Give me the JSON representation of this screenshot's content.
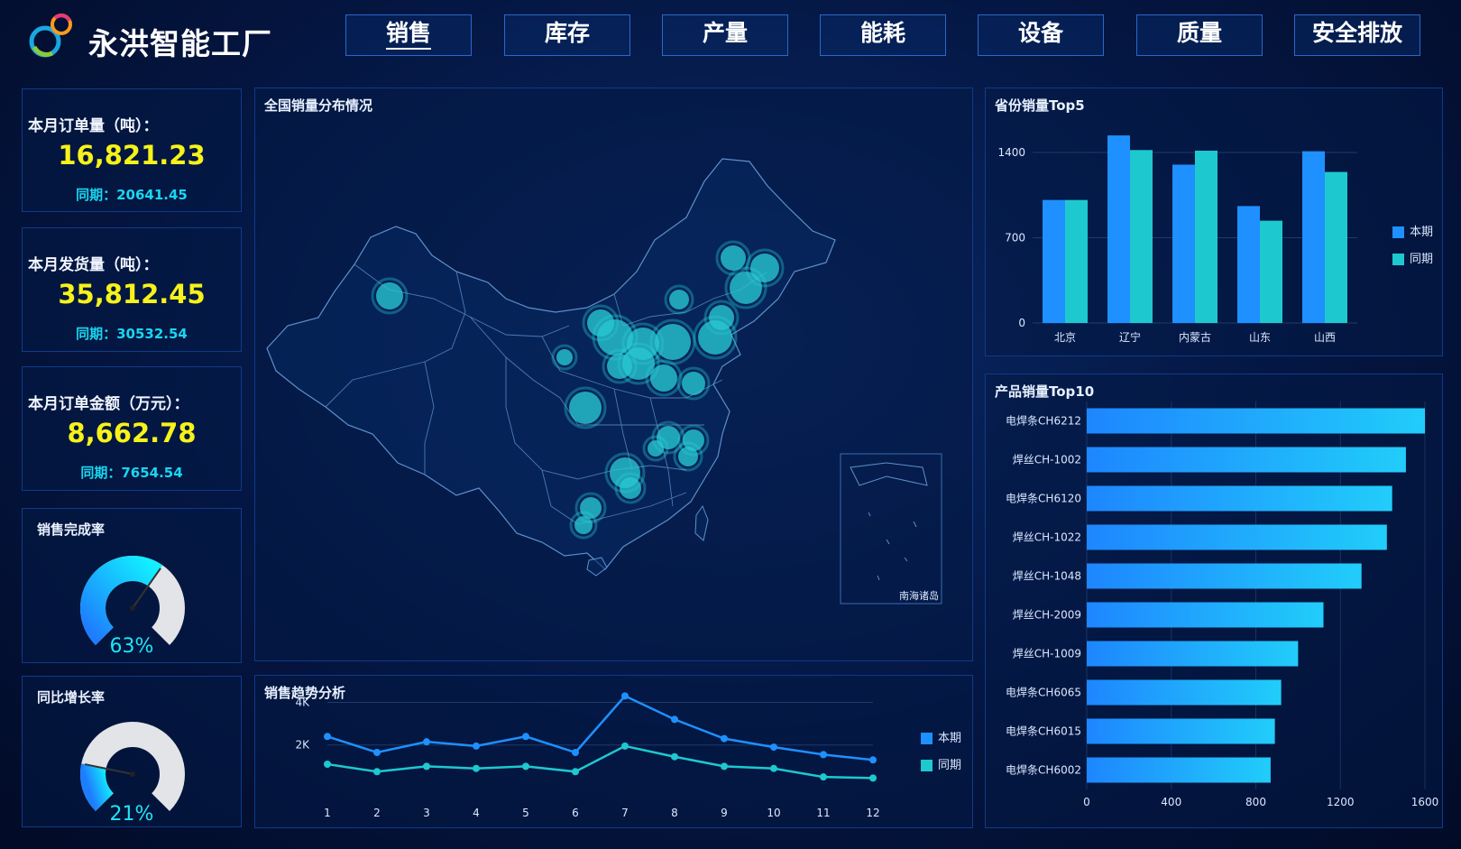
{
  "header": {
    "title": "永洪智能工厂",
    "nav": [
      {
        "label": "销售",
        "active": true
      },
      {
        "label": "库存",
        "active": false
      },
      {
        "label": "产量",
        "active": false
      },
      {
        "label": "能耗",
        "active": false
      },
      {
        "label": "设备",
        "active": false
      },
      {
        "label": "质量",
        "active": false
      },
      {
        "label": "安全排放",
        "active": false
      }
    ]
  },
  "stats": [
    {
      "label": "本月订单量（吨）：",
      "value": "16,821.23",
      "sub": "同期：20641.45"
    },
    {
      "label": "本月发货量（吨）：",
      "value": "35,812.45",
      "sub": "同期：30532.54"
    },
    {
      "label": "本月订单金额（万元）：",
      "value": "8,662.78",
      "sub": "同期：7654.54"
    }
  ],
  "gauges": [
    {
      "title": "销售完成率",
      "value": 63,
      "display": "63%"
    },
    {
      "title": "同比增长率",
      "value": 21,
      "display": "21%"
    }
  ],
  "map_panel": {
    "title": "全国销量分布情况",
    "inset_label": "南海诸岛"
  },
  "trend_panel": {
    "title": "销售趋势分析"
  },
  "province_panel": {
    "title": "省份销量Top5"
  },
  "product_panel": {
    "title": "产品销量Top10"
  },
  "legend": {
    "current": "本期",
    "previous": "同期"
  },
  "colors": {
    "current": "#1e90ff",
    "previous": "#1ec8cf",
    "accent_value": "#f6f21a",
    "accent_sub": "#19d6f0"
  },
  "chart_data": [
    {
      "type": "bar",
      "title": "省份销量Top5",
      "categories": [
        "北京",
        "辽宁",
        "内蒙古",
        "山东",
        "山西"
      ],
      "series": [
        {
          "name": "本期",
          "values": [
            1010,
            1540,
            1300,
            960,
            1410
          ]
        },
        {
          "name": "同期",
          "values": [
            1010,
            1420,
            1415,
            840,
            1240
          ]
        }
      ],
      "yticks": [
        "0",
        "700",
        "1400"
      ],
      "ylim": [
        0,
        1600
      ],
      "legend": "right"
    },
    {
      "type": "bar",
      "orientation": "horizontal",
      "title": "产品销量Top10",
      "categories": [
        "电焊条CH6212",
        "焊丝CH-1002",
        "电焊条CH6120",
        "焊丝CH-1022",
        "焊丝CH-1048",
        "焊丝CH-2009",
        "焊丝CH-1009",
        "电焊条CH6065",
        "电焊条CH6015",
        "电焊条CH6002"
      ],
      "values": [
        1620,
        1510,
        1445,
        1420,
        1300,
        1120,
        1000,
        920,
        890,
        870
      ],
      "xticks": [
        "0",
        "400",
        "800",
        "1200",
        "1600"
      ],
      "xlim": [
        0,
        1600
      ]
    },
    {
      "type": "line",
      "title": "销售趋势分析",
      "x": [
        "1",
        "2",
        "3",
        "4",
        "5",
        "6",
        "7",
        "8",
        "9",
        "10",
        "11",
        "12"
      ],
      "series": [
        {
          "name": "本期",
          "values": [
            2400,
            1650,
            2150,
            1950,
            2400,
            1650,
            4300,
            3200,
            2300,
            1900,
            1550,
            1300
          ]
        },
        {
          "name": "同期",
          "values": [
            1100,
            750,
            1000,
            900,
            1000,
            750,
            1950,
            1450,
            1000,
            900,
            500,
            450
          ]
        }
      ],
      "yticks": [
        "2K",
        "4K"
      ],
      "ylim": [
        0,
        4400
      ],
      "legend": "right"
    }
  ],
  "map_points": [
    {
      "x": 431,
      "y": 327,
      "r": 15
    },
    {
      "x": 812,
      "y": 285,
      "r": 14
    },
    {
      "x": 847,
      "y": 296,
      "r": 16
    },
    {
      "x": 826,
      "y": 318,
      "r": 18
    },
    {
      "x": 752,
      "y": 331,
      "r": 11
    },
    {
      "x": 799,
      "y": 351,
      "r": 14
    },
    {
      "x": 665,
      "y": 357,
      "r": 15
    },
    {
      "x": 681,
      "y": 373,
      "r": 20
    },
    {
      "x": 712,
      "y": 380,
      "r": 18
    },
    {
      "x": 745,
      "y": 378,
      "r": 20
    },
    {
      "x": 792,
      "y": 373,
      "r": 19
    },
    {
      "x": 707,
      "y": 402,
      "r": 18
    },
    {
      "x": 686,
      "y": 405,
      "r": 14
    },
    {
      "x": 625,
      "y": 395,
      "r": 9
    },
    {
      "x": 735,
      "y": 418,
      "r": 15
    },
    {
      "x": 768,
      "y": 424,
      "r": 13
    },
    {
      "x": 648,
      "y": 451,
      "r": 18
    },
    {
      "x": 740,
      "y": 484,
      "r": 13
    },
    {
      "x": 768,
      "y": 487,
      "r": 12
    },
    {
      "x": 762,
      "y": 505,
      "r": 11
    },
    {
      "x": 726,
      "y": 496,
      "r": 9
    },
    {
      "x": 692,
      "y": 523,
      "r": 17
    },
    {
      "x": 698,
      "y": 540,
      "r": 12
    },
    {
      "x": 654,
      "y": 562,
      "r": 12
    },
    {
      "x": 646,
      "y": 581,
      "r": 10
    }
  ]
}
